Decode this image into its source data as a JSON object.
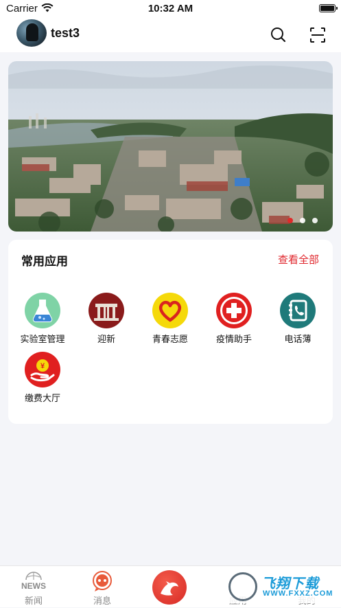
{
  "status_bar": {
    "carrier": "Carrier",
    "time": "10:32 AM"
  },
  "header": {
    "username": "test3",
    "search_icon": "search-icon",
    "scan_icon": "scan-icon"
  },
  "banner": {
    "pages": 3,
    "active_page": 1
  },
  "apps": {
    "title": "常用应用",
    "view_all": "查看全部",
    "items": [
      {
        "label": "实验室管理",
        "icon": "flask-icon",
        "color": "#7fd3a6"
      },
      {
        "label": "迎新",
        "icon": "gate-icon",
        "color": "#8a1b1b"
      },
      {
        "label": "青春志愿",
        "icon": "heart-icon",
        "color": "#f5d90a"
      },
      {
        "label": "疫情助手",
        "icon": "medical-cross-icon",
        "color": "#e02020"
      },
      {
        "label": "电话薄",
        "icon": "phonebook-icon",
        "color": "#1f7a7a"
      },
      {
        "label": "缴费大厅",
        "icon": "yuan-payment-icon",
        "color": "#e02020"
      }
    ]
  },
  "tabbar": {
    "items": [
      {
        "label": "新闻",
        "icon": "news-icon"
      },
      {
        "label": "消息",
        "icon": "message-icon"
      },
      {
        "label": "",
        "icon": "home-center-icon"
      },
      {
        "label": "应用",
        "icon": "apps-icon"
      },
      {
        "label": "我的",
        "icon": "profile-icon"
      }
    ],
    "news_icon_text": "NEWS"
  },
  "watermark": {
    "main": "飞翔下载",
    "sub": "WWW.FXXZ.COM"
  },
  "colors": {
    "accent": "#e0262c",
    "background": "#f4f5f9",
    "card": "#ffffff"
  }
}
